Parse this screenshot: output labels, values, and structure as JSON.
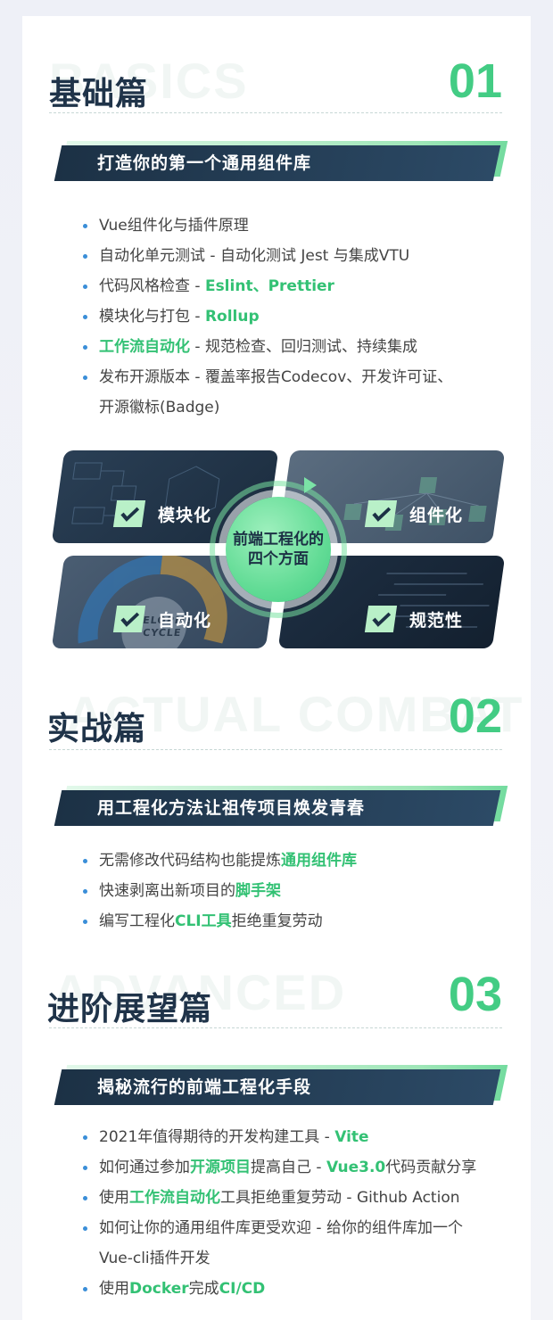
{
  "sections": [
    {
      "ghost": "BASICS",
      "title": "基础篇",
      "num": "01",
      "banner": "打造你的第一个通用组件库",
      "items": [
        {
          "t1": "Vue组件化与插件原理"
        },
        {
          "t1": "自动化单元测试 - 自动化测试 Jest 与集成VTU"
        },
        {
          "t1": "代码风格检查 - ",
          "hl": "Eslint、Prettier"
        },
        {
          "t1": "模块化与打包 - ",
          "hl": "Rollup"
        },
        {
          "hl": "工作流自动化",
          "t2": " - 规范检查、回归测试、持续集成"
        },
        {
          "t1": "发布开源版本 - 覆盖率报告Codecov、开发许可证、",
          "cont": "开源徽标(Badge)"
        }
      ]
    },
    {
      "ghost": "ACTUAL COMBAT",
      "title": "实战篇",
      "num": "02",
      "banner": "用工程化方法让祖传项目焕发青春",
      "items": [
        {
          "t1": "无需修改代码结构也能提炼",
          "hl": "通用组件库"
        },
        {
          "t1": "快速剥离出新项目的",
          "hl": "脚手架"
        },
        {
          "t1": "编写工程化",
          "hl": "CLI工具",
          "t2": "拒绝重复劳动"
        }
      ]
    },
    {
      "ghost": "ADVANCED",
      "title": "进阶展望篇",
      "num": "03",
      "banner": "揭秘流行的前端工程化手段",
      "items": [
        {
          "t1": "2021年值得期待的开发构建工具 - ",
          "hl": "Vite"
        },
        {
          "t1": "如何通过参加",
          "hl": "开源项目",
          "t2": "提高自己 - ",
          "hl2": "Vue3.0",
          "t3": "代码贡献分享"
        },
        {
          "t1": "使用",
          "hl": "工作流自动化",
          "t2": "工具拒绝重复劳动 - Github Action"
        },
        {
          "t1": "如何让你的通用组件库更受欢迎 - 给你的组件库加一个",
          "cont": "Vue-cli插件开发"
        },
        {
          "t1": "使用",
          "hl": "Docker",
          "t2": "完成",
          "hl2": "CI/CD"
        }
      ]
    }
  ],
  "diagram": {
    "center_line1": "前端工程化的",
    "center_line2": "四个方面",
    "q1_label": "模块化",
    "q2_label": "组件化",
    "q3_label": "自动化",
    "q3_bg_line1": "DEVELOPMENT",
    "q3_bg_line2": "CYCLE",
    "q4_label": "规范性"
  },
  "colors": {
    "accent": "#43cc84",
    "highlight": "#33c174",
    "title": "#1f3349",
    "banner": "#1c3145",
    "bullet": "#3a8ed8"
  }
}
